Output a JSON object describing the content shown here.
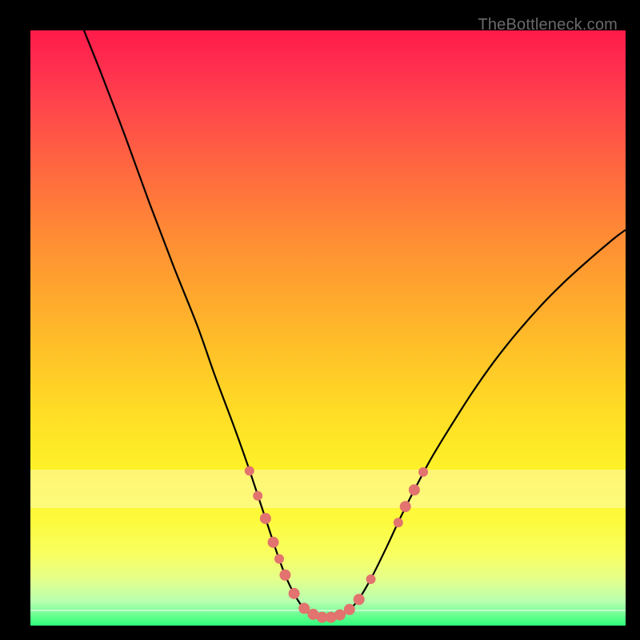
{
  "site_label": "TheBottleneck.com",
  "chart_data": {
    "type": "line",
    "title": "",
    "xlabel": "",
    "ylabel": "",
    "xlim": [
      0,
      100
    ],
    "ylim": [
      0,
      100
    ],
    "pale_band_y_range": [
      19.8,
      26.2
    ],
    "white_line_y": [
      97.5
    ],
    "curve": [
      {
        "x": 9.0,
        "y": 100.0
      },
      {
        "x": 12.0,
        "y": 92.5
      },
      {
        "x": 16.0,
        "y": 82.0
      },
      {
        "x": 20.0,
        "y": 71.0
      },
      {
        "x": 24.0,
        "y": 60.5
      },
      {
        "x": 28.0,
        "y": 50.5
      },
      {
        "x": 31.0,
        "y": 42.0
      },
      {
        "x": 34.0,
        "y": 34.0
      },
      {
        "x": 36.5,
        "y": 27.0
      },
      {
        "x": 38.5,
        "y": 21.0
      },
      {
        "x": 40.0,
        "y": 16.5
      },
      {
        "x": 41.5,
        "y": 12.0
      },
      {
        "x": 43.0,
        "y": 8.0
      },
      {
        "x": 44.5,
        "y": 5.0
      },
      {
        "x": 46.0,
        "y": 2.8
      },
      {
        "x": 47.5,
        "y": 1.6
      },
      {
        "x": 49.0,
        "y": 1.2
      },
      {
        "x": 50.5,
        "y": 1.2
      },
      {
        "x": 52.0,
        "y": 1.6
      },
      {
        "x": 53.5,
        "y": 2.6
      },
      {
        "x": 55.0,
        "y": 4.2
      },
      {
        "x": 56.5,
        "y": 6.6
      },
      {
        "x": 58.0,
        "y": 9.4
      },
      {
        "x": 60.0,
        "y": 13.5
      },
      {
        "x": 62.0,
        "y": 17.8
      },
      {
        "x": 64.0,
        "y": 21.8
      },
      {
        "x": 67.0,
        "y": 27.5
      },
      {
        "x": 70.0,
        "y": 32.5
      },
      {
        "x": 74.0,
        "y": 38.8
      },
      {
        "x": 78.0,
        "y": 44.5
      },
      {
        "x": 82.0,
        "y": 49.5
      },
      {
        "x": 86.0,
        "y": 54.0
      },
      {
        "x": 90.0,
        "y": 58.0
      },
      {
        "x": 94.0,
        "y": 61.6
      },
      {
        "x": 98.0,
        "y": 65.0
      },
      {
        "x": 100.0,
        "y": 66.5
      }
    ],
    "dots": [
      {
        "x": 36.8,
        "y": 26.0,
        "r": 6
      },
      {
        "x": 38.2,
        "y": 21.8,
        "r": 6
      },
      {
        "x": 39.5,
        "y": 18.0,
        "r": 7
      },
      {
        "x": 40.8,
        "y": 14.0,
        "r": 7
      },
      {
        "x": 41.8,
        "y": 11.2,
        "r": 6
      },
      {
        "x": 42.8,
        "y": 8.5,
        "r": 7
      },
      {
        "x": 44.3,
        "y": 5.4,
        "r": 7
      },
      {
        "x": 46.0,
        "y": 2.9,
        "r": 7
      },
      {
        "x": 47.5,
        "y": 1.9,
        "r": 7
      },
      {
        "x": 49.0,
        "y": 1.4,
        "r": 7
      },
      {
        "x": 50.5,
        "y": 1.4,
        "r": 7
      },
      {
        "x": 52.0,
        "y": 1.8,
        "r": 7
      },
      {
        "x": 53.6,
        "y": 2.7,
        "r": 7
      },
      {
        "x": 55.2,
        "y": 4.4,
        "r": 7
      },
      {
        "x": 57.2,
        "y": 7.8,
        "r": 6
      },
      {
        "x": 61.8,
        "y": 17.3,
        "r": 6
      },
      {
        "x": 63.0,
        "y": 20.0,
        "r": 7
      },
      {
        "x": 64.5,
        "y": 22.8,
        "r": 7
      },
      {
        "x": 66.0,
        "y": 25.8,
        "r": 6
      }
    ]
  }
}
